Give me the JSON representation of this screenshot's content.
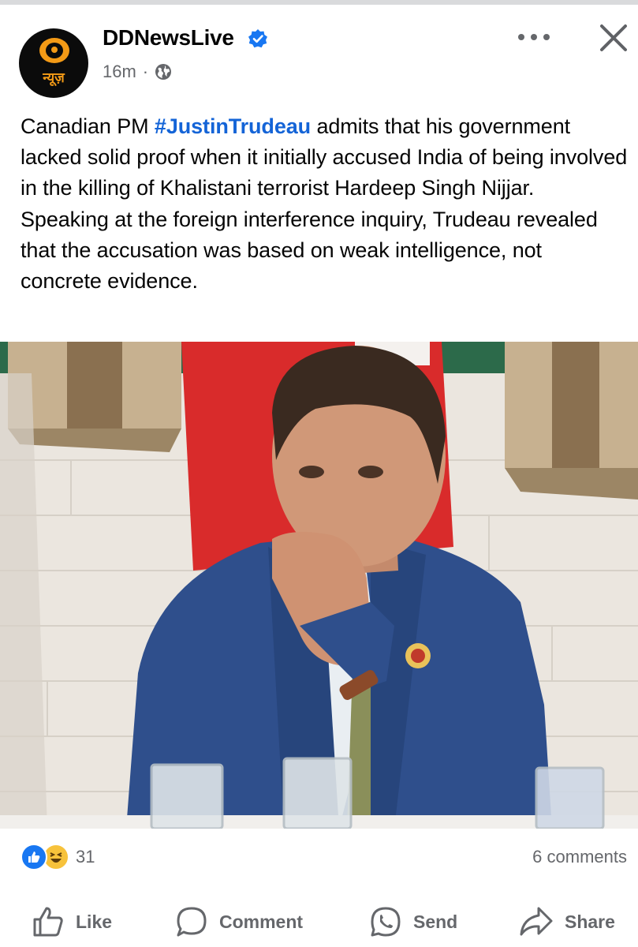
{
  "post": {
    "page_name": "DDNewsLive",
    "verified_icon": "verified-badge-icon",
    "time": "16m",
    "separator": "·",
    "audience_icon": "globe-icon",
    "avatar_logo_text": "न्यूज़",
    "text_before": "Canadian PM ",
    "hashtag": "#JustinTrudeau",
    "text_after": " admits that his government lacked solid proof when it initially accused India of being involved in the killing of Khalistani terrorist Hardeep Singh Nijjar. Speaking at the foreign interference inquiry, Trudeau revealed that the accusation was based on weak intelligence, not concrete evidence."
  },
  "header_controls": {
    "more_icon": "more-dots-icon",
    "close_icon": "close-icon"
  },
  "reactions": {
    "types": [
      "like",
      "haha"
    ],
    "count": "31",
    "comments": "6 comments"
  },
  "actions": {
    "like": "Like",
    "comment": "Comment",
    "send": "Send",
    "share": "Share"
  },
  "colors": {
    "brand_blue": "#1877f2",
    "hashtag": "#1464d7",
    "secondary_text": "#65676b",
    "logo_orange": "#f39a16"
  }
}
